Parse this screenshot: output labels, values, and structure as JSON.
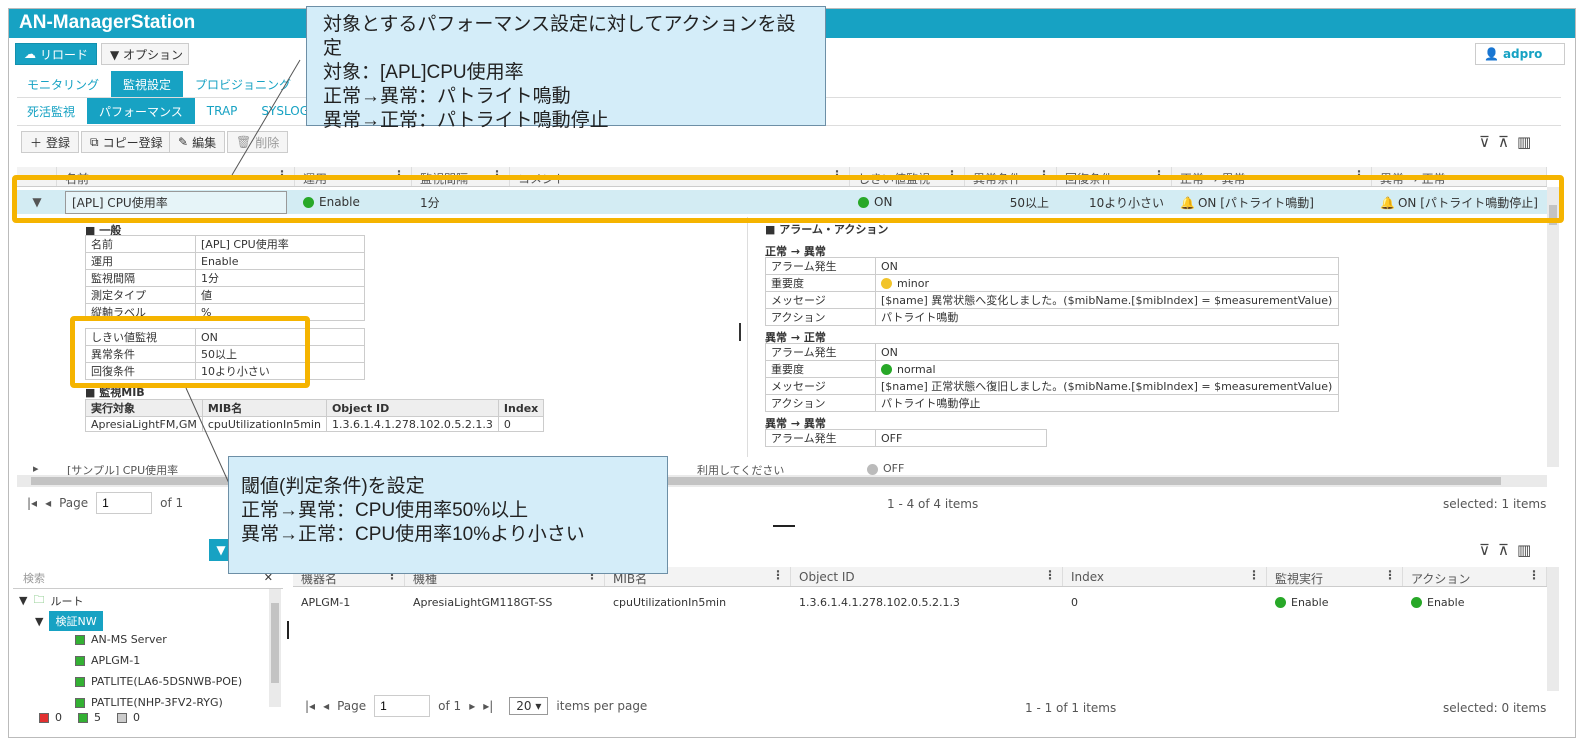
{
  "app": {
    "title": "AN-ManagerStation"
  },
  "toolbar": {
    "reload": "リロード",
    "options": "▼ オプション",
    "user": "adpro"
  },
  "main_tabs": [
    "モニタリング",
    "監視設定",
    "プロビジョニング"
  ],
  "sub_tabs": [
    "死活監視",
    "パフォーマンス",
    "TRAP",
    "SYSLOG"
  ],
  "actions": {
    "register": "登録",
    "copy_register": "コピー登録",
    "edit": "編集",
    "delete": "削除"
  },
  "grid": {
    "columns": [
      "名前",
      "運用",
      "監視間隔",
      "コメント",
      "しきい値監視",
      "異常条件",
      "回復条件",
      "正常 → 異常",
      "異常 → 正常"
    ],
    "row": {
      "name": "[APL] CPU使用率",
      "status": "Enable",
      "interval": "1分",
      "threshold": "ON",
      "abnormal": "50以上",
      "recovery": "10より小さい",
      "normal_to_abnormal": "ON [パトライト鳴動]",
      "abnormal_to_normal": "ON [パトライト鳴動停止]"
    },
    "next_row": {
      "name": "[サンプル] CPU使用率",
      "comment": "利用してください",
      "threshold": "OFF"
    }
  },
  "detail": {
    "general_title": "一般",
    "general": [
      [
        "名前",
        "[APL] CPU使用率"
      ],
      [
        "運用",
        "Enable"
      ],
      [
        "監視間隔",
        "1分"
      ],
      [
        "測定タイプ",
        "値"
      ],
      [
        "縦軸ラベル",
        "%"
      ]
    ],
    "threshold": [
      [
        "しきい値監視",
        "ON"
      ],
      [
        "異常条件",
        "50以上"
      ],
      [
        "回復条件",
        "10より小さい"
      ]
    ],
    "mib_title": "監視MIB",
    "mib_headers": [
      "実行対象",
      "MIB名",
      "Object ID",
      "Index"
    ],
    "mib_row": [
      "ApresiaLightFM,GM",
      "cpuUtilizationIn5min",
      "1.3.6.1.4.1.278.102.0.5.2.1.3",
      "0"
    ],
    "alarm_title": "アラーム・アクション",
    "n2a_title": "正常 → 異常",
    "n2a": [
      [
        "アラーム発生",
        "ON"
      ],
      [
        "重要度",
        "minor"
      ],
      [
        "メッセージ",
        "[$name] 異常状態へ変化しました。($mibName.[$mibIndex] = $measurementValue)"
      ],
      [
        "アクション",
        "パトライト鳴動"
      ]
    ],
    "a2n_title": "異常 → 正常",
    "a2n": [
      [
        "アラーム発生",
        "ON"
      ],
      [
        "重要度",
        "normal"
      ],
      [
        "メッセージ",
        "[$name] 正常状態へ復旧しました。($mibName.[$mibIndex] = $measurementValue)"
      ],
      [
        "アクション",
        "パトライト鳴動停止"
      ]
    ],
    "a2a_title": "異常 → 異常",
    "a2a": [
      [
        "アラーム発生",
        "OFF"
      ]
    ]
  },
  "pager_top": {
    "page_label": "Page",
    "page": "1",
    "of": "of 1",
    "items": "1 - 4 of 4 items",
    "selected": "selected: 1 items"
  },
  "tree": {
    "search_placeholder": "検索",
    "root": "ルート",
    "group": "検証NW",
    "items": [
      "AN-MS Server",
      "APLGM-1",
      "PATLITE(LA6-5DSNWB-POE)",
      "PATLITE(NHP-3FV2-RYG)"
    ],
    "counts": {
      "red": "0",
      "green": "5",
      "gray": "0"
    }
  },
  "bottom_grid": {
    "columns": [
      "機器名",
      "機種",
      "MIB名",
      "Object ID",
      "Index",
      "監視実行",
      "アクション"
    ],
    "row": [
      "APLGM-1",
      "ApresiaLightGM118GT-SS",
      "cpuUtilizationIn5min",
      "1.3.6.1.4.1.278.102.0.5.2.1.3",
      "0",
      "Enable",
      "Enable"
    ]
  },
  "pager_bottom": {
    "page_label": "Page",
    "page": "1",
    "of": "of 1",
    "per_page": "20",
    "per_page_label": "items per page",
    "items": "1 - 1 of 1 items",
    "selected": "selected: 0 items"
  },
  "callout_top": [
    "対象とするパフォーマンス設定に対してアクションを設定",
    "対象：[APL]CPU使用率",
    "正常→異常：パトライト鳴動",
    "異常→正常：パトライト鳴動停止"
  ],
  "callout_bottom": [
    "閾値(判定条件)を設定",
    "正常→異常：CPU使用率50%以上",
    "異常→正常：CPU使用率10%より小さい"
  ],
  "colors": {
    "accent": "#17a2c3",
    "highlight": "#f5b400",
    "callout_bg": "#d4edf9"
  }
}
